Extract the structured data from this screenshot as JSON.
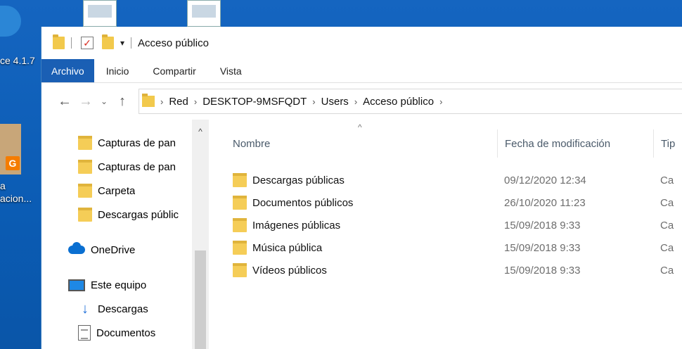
{
  "desktop": {
    "label_top": "ce 4.1.7",
    "label_mid1": "a",
    "label_mid2": "acion...",
    "badge": "G"
  },
  "window": {
    "title": "Acceso público",
    "ribbon_tabs": [
      "Archivo",
      "Inicio",
      "Compartir",
      "Vista"
    ],
    "address": {
      "crumbs": [
        "Red",
        "DESKTOP-9MSFQDT",
        "Users",
        "Acceso público"
      ]
    },
    "nav_pane": {
      "items": [
        {
          "label": "Capturas de pan",
          "icon": "folder-icon"
        },
        {
          "label": "Capturas de pan",
          "icon": "folder-icon"
        },
        {
          "label": "Carpeta",
          "icon": "folder-icon"
        },
        {
          "label": "Descargas públic",
          "icon": "folder-icon"
        }
      ],
      "onedrive": "OneDrive",
      "thispc": "Este equipo",
      "pc_items": [
        {
          "label": "Descargas",
          "icon": "download-icon"
        },
        {
          "label": "Documentos",
          "icon": "document-icon"
        }
      ]
    },
    "columns": {
      "name": "Nombre",
      "date": "Fecha de modificación",
      "type": "Tip"
    },
    "files": [
      {
        "name": "Descargas públicas",
        "date": "09/12/2020 12:34",
        "type": "Ca"
      },
      {
        "name": "Documentos públicos",
        "date": "26/10/2020 11:23",
        "type": "Ca"
      },
      {
        "name": "Imágenes públicas",
        "date": "15/09/2018 9:33",
        "type": "Ca"
      },
      {
        "name": "Música pública",
        "date": "15/09/2018 9:33",
        "type": "Ca"
      },
      {
        "name": "Vídeos públicos",
        "date": "15/09/2018 9:33",
        "type": "Ca"
      }
    ]
  }
}
